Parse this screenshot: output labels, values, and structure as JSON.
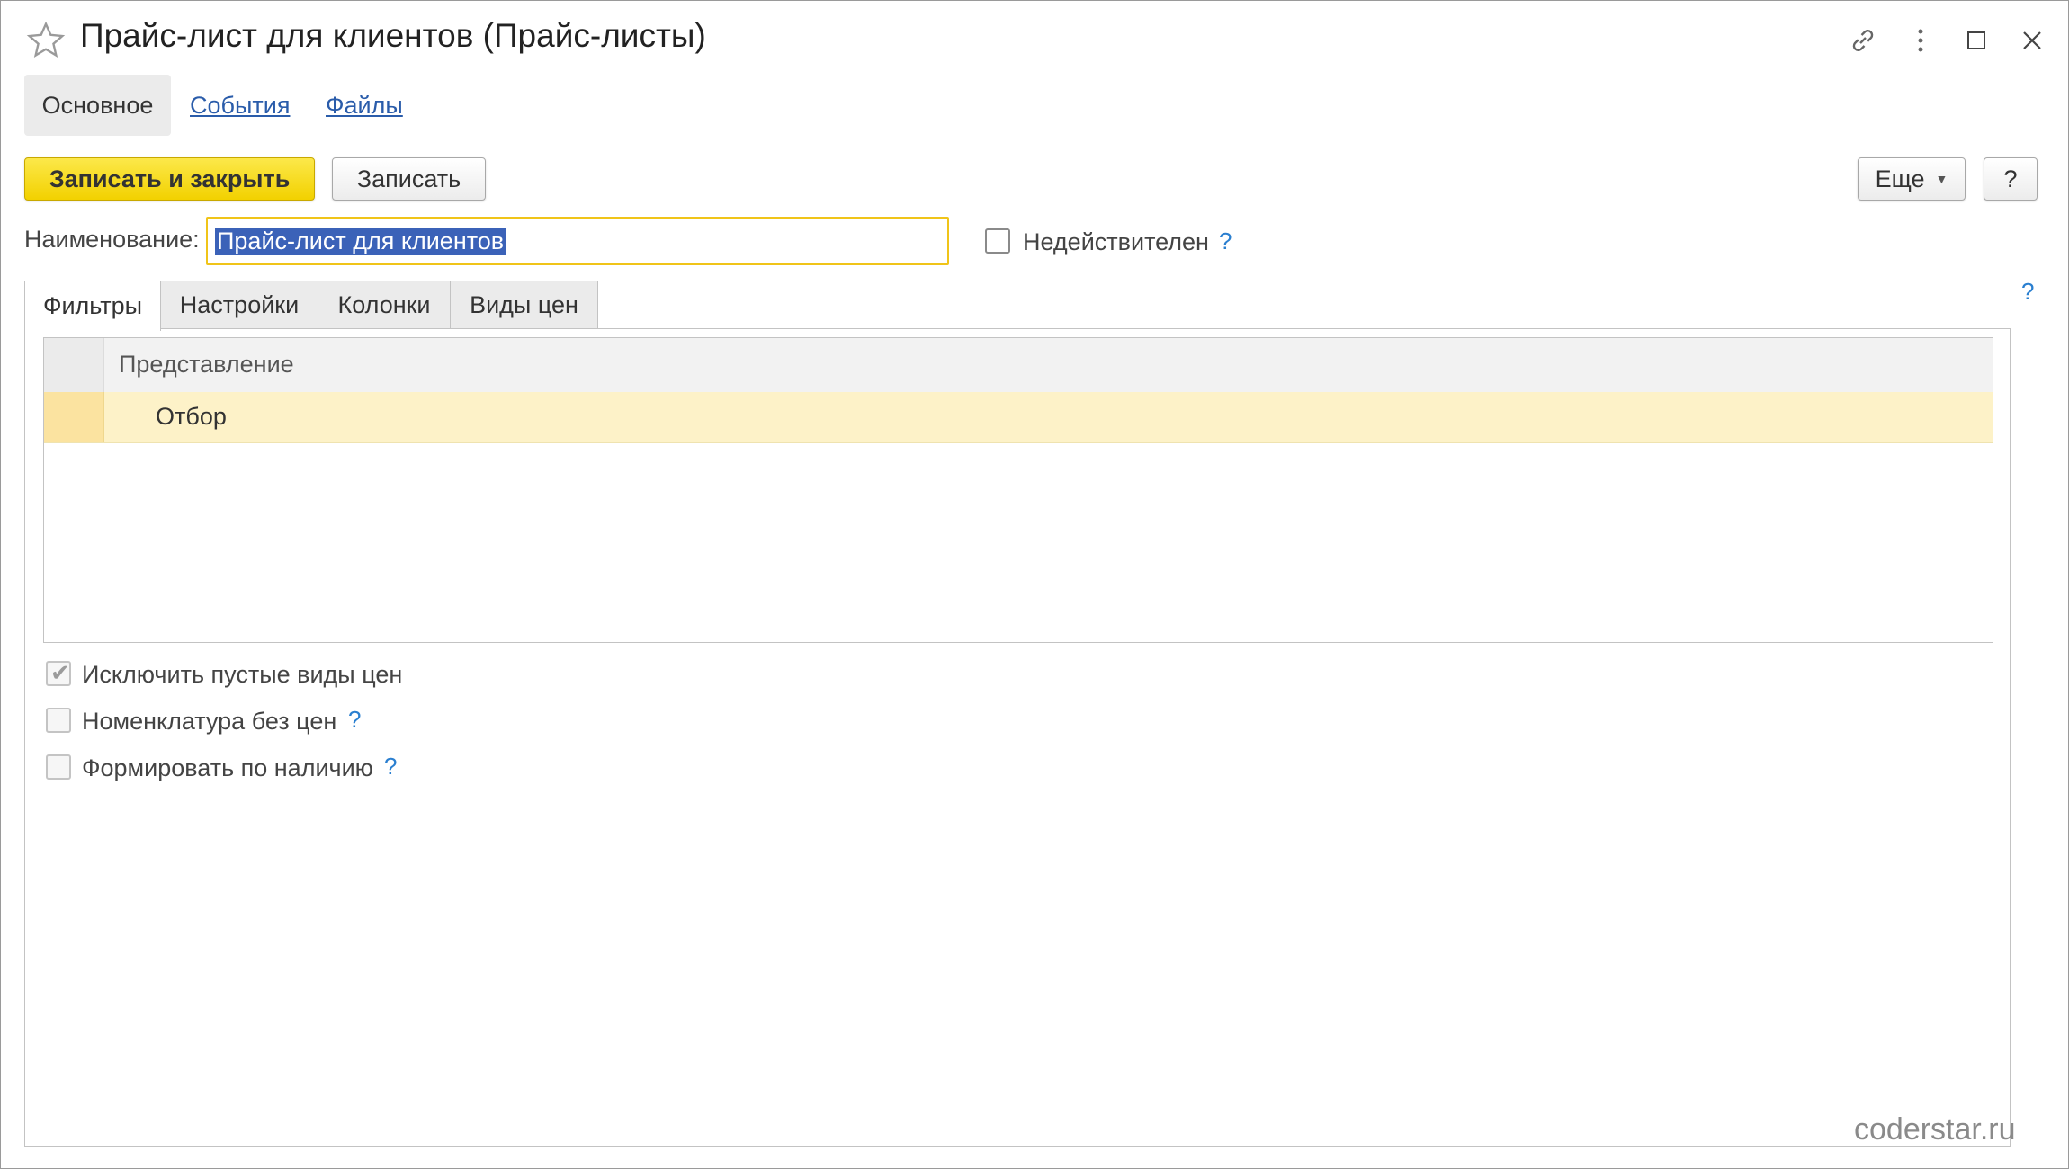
{
  "window": {
    "title": "Прайс-лист для клиентов (Прайс-листы)"
  },
  "section_tabs": [
    {
      "label": "Основное",
      "active": true
    },
    {
      "label": "События",
      "active": false
    },
    {
      "label": "Файлы",
      "active": false
    }
  ],
  "toolbar": {
    "save_close_label": "Записать и закрыть",
    "save_label": "Записать",
    "more_label": "Еще",
    "help_label": "?"
  },
  "form": {
    "name_label": "Наименование:",
    "name_value": "Прайс-лист для клиентов",
    "invalid_label": "Недействителен",
    "help_mark": "?"
  },
  "tabs": [
    {
      "label": "Фильтры",
      "active": true
    },
    {
      "label": "Настройки",
      "active": false
    },
    {
      "label": "Колонки",
      "active": false
    },
    {
      "label": "Виды цен",
      "active": false
    }
  ],
  "table": {
    "column_header": "Представление",
    "rows": [
      {
        "text": "Отбор"
      }
    ]
  },
  "options": [
    {
      "label": "Исключить пустые виды цен",
      "checked": true,
      "disabled": true,
      "has_help": false
    },
    {
      "label": "Номенклатура без цен",
      "checked": false,
      "disabled": true,
      "has_help": true
    },
    {
      "label": "Формировать по наличию",
      "checked": false,
      "disabled": true,
      "has_help": true
    }
  ],
  "watermark": "coderstar.ru",
  "colors": {
    "primary_button": "#f2d100",
    "link": "#2a5caa",
    "selection": "#3b62b8",
    "row_highlight": "#fdf2c8",
    "help": "#2a7fd0"
  }
}
